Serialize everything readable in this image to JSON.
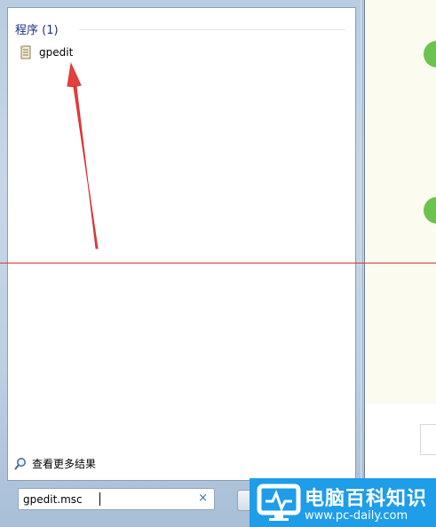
{
  "start_menu": {
    "section_title": "程序 (1)",
    "results": [
      {
        "label": "gpedit",
        "icon": "document-icon"
      }
    ],
    "see_more_label": "查看更多结果",
    "search": {
      "value": "gpedit.msc",
      "clear_symbol": "×"
    }
  },
  "watermark": {
    "title": "电脑百科知识",
    "url": "www.pc-daily.com"
  },
  "colors": {
    "accent_green": "#6cc34f",
    "annotation_red": "#e03131",
    "watermark_blue": "#1e9de8"
  }
}
